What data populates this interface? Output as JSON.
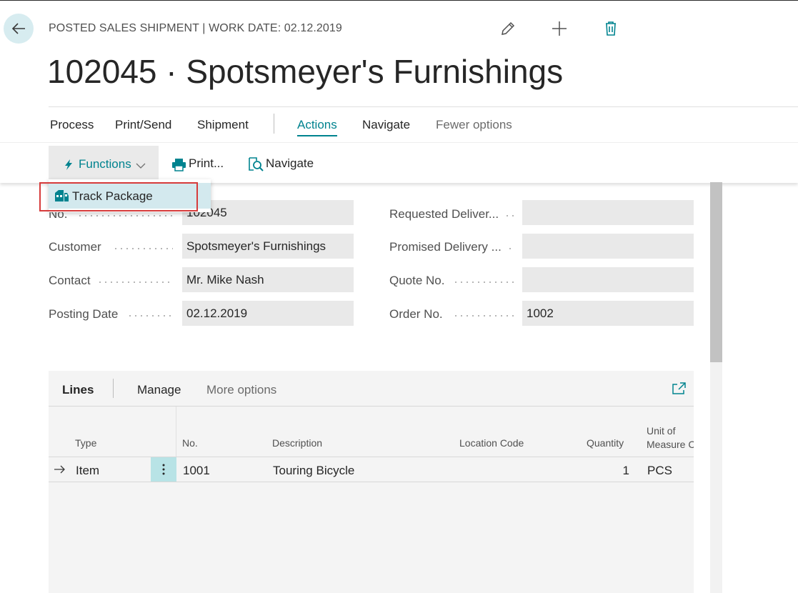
{
  "header": {
    "caption": "POSTED SALES SHIPMENT | WORK DATE: 02.12.2019",
    "title": "102045 · Spotsmeyer's Furnishings",
    "icons": [
      "back-arrow-icon",
      "edit-pencil-icon",
      "add-plus-icon",
      "delete-trash-icon"
    ]
  },
  "menu": {
    "items": [
      "Process",
      "Print/Send",
      "Shipment",
      "Actions",
      "Navigate",
      "Fewer options"
    ],
    "active": "Actions"
  },
  "actionbar": {
    "functions_label": "Functions",
    "print_label": "Print...",
    "navigate_label": "Navigate"
  },
  "dropdown": {
    "items": [
      "Track Package"
    ]
  },
  "form": {
    "left": [
      {
        "label": "No.",
        "value": "102045"
      },
      {
        "label": "Customer",
        "value": "Spotsmeyer's Furnishings"
      },
      {
        "label": "Contact",
        "value": "Mr. Mike Nash"
      },
      {
        "label": "Posting Date",
        "value": "02.12.2019"
      }
    ],
    "right": [
      {
        "label": "Requested Deliver...",
        "value": ""
      },
      {
        "label": "Promised Delivery ...",
        "value": ""
      },
      {
        "label": "Quote No.",
        "value": ""
      },
      {
        "label": "Order No.",
        "value": "1002"
      }
    ]
  },
  "lines": {
    "tabs": [
      "Lines",
      "Manage",
      "More options"
    ],
    "columns": {
      "type": "Type",
      "no": "No.",
      "description": "Description",
      "location_code": "Location Code",
      "quantity": "Quantity",
      "unit_line1": "Unit of",
      "unit_line2": "Measure C"
    },
    "rows": [
      {
        "type": "Item",
        "no": "1001",
        "description": "Touring Bicycle",
        "location_code": "",
        "quantity": "1",
        "unit": "PCS"
      }
    ]
  },
  "colors": {
    "accent": "#00838f",
    "highlight_border": "#d63b3b",
    "selection": "#d3e9ee"
  }
}
